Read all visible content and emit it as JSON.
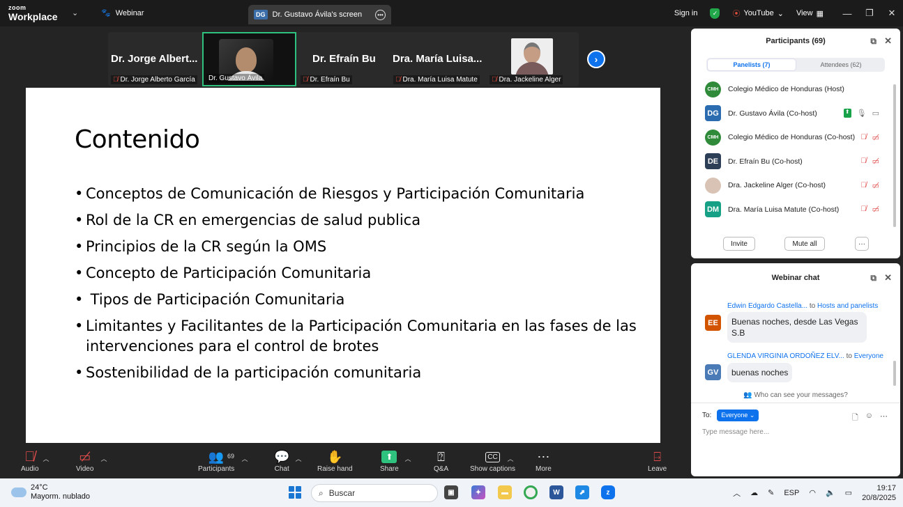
{
  "titlebar": {
    "brand_small": "zoom",
    "brand_large": "Workplace",
    "webinar_label": "Webinar",
    "screen_tab_badge": "DG",
    "screen_tab_label": "Dr. Gustavo Ávila's screen",
    "sign_in": "Sign in",
    "youtube": "YouTube",
    "view": "View"
  },
  "strip": {
    "tiles": [
      {
        "big": "Dr. Jorge Albert...",
        "small": "Dr. Jorge Alberto García"
      },
      {
        "small": "Dr. Gustavo Ávila"
      },
      {
        "big": "Dr. Efraín Bu",
        "small": "Dr. Efraín Bu"
      },
      {
        "big": "Dra. María Luisa...",
        "small": "Dra. María Luisa Matute"
      },
      {
        "small": "Dra. Jackeline Alger"
      }
    ]
  },
  "slide": {
    "title": "Contenido",
    "bullets": [
      "Conceptos de Comunicación de Riesgos y Participación Comunitaria",
      "Rol de la CR en emergencias de salud publica",
      "Principios de la CR según la OMS",
      "Concepto de Participación Comunitaria",
      " Tipos de Participación Comunitaria",
      "Limitantes y Facilitantes de la Participación Comunitaria en las fases de las intervenciones para el control de brotes",
      "Sostenibilidad de la participación comunitaria"
    ]
  },
  "toolbar": {
    "audio": "Audio",
    "video": "Video",
    "participants": "Participants",
    "participants_count": "69",
    "chat": "Chat",
    "raise_hand": "Raise hand",
    "share": "Share",
    "qa": "Q&A",
    "captions": "Show captions",
    "more": "More",
    "leave": "Leave"
  },
  "participants_panel": {
    "title": "Participants (69)",
    "tab_panelists": "Panelists (7)",
    "tab_attendees": "Attendees (62)",
    "list": [
      {
        "initials": "CMH",
        "name": "Colegio Médico de Honduras (Host)"
      },
      {
        "initials": "DG",
        "name": "Dr. Gustavo Ávila (Co-host)"
      },
      {
        "initials": "CMH",
        "name": "Colegio Médico de Honduras (Co-host)"
      },
      {
        "initials": "DE",
        "name": "Dr. Efraín Bu (Co-host)"
      },
      {
        "initials": "",
        "name": "Dra. Jackeline Alger (Co-host)"
      },
      {
        "initials": "DM",
        "name": "Dra. María Luisa Matute (Co-host)"
      }
    ],
    "invite": "Invite",
    "mute_all": "Mute all",
    "more": "···"
  },
  "chat_panel": {
    "title": "Webinar chat",
    "messages": [
      {
        "initials": "EE",
        "sender": "Edwin Edgardo Castella...",
        "to_word": "to",
        "recipient": "Hosts and panelists",
        "text": "Buenas noches, desde Las Vegas S.B"
      },
      {
        "initials": "GV",
        "sender": "GLENDA VIRGINIA ORDOÑEZ ELV...",
        "to_word": "to",
        "recipient": "Everyone",
        "text": "buenas noches"
      }
    ],
    "who_can_see": "Who can see your messages?",
    "to_label": "To:",
    "everyone": "Everyone",
    "placeholder": "Type message here..."
  },
  "taskbar": {
    "temp": "24°C",
    "weather": "Mayorm. nublado",
    "search": "Buscar",
    "lang": "ESP",
    "time": "19:17",
    "date": "20/8/2025"
  },
  "colors": {
    "accent": "#0e72ed",
    "active_tile": "#2ec27e",
    "muted": "#e04c4c"
  }
}
